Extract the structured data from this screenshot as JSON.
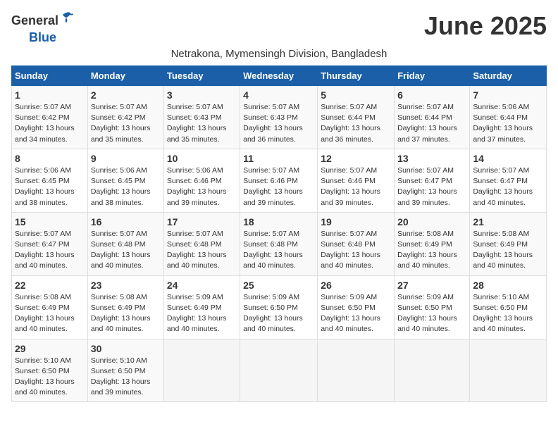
{
  "logo": {
    "general": "General",
    "blue": "Blue"
  },
  "title": "June 2025",
  "subtitle": "Netrakona, Mymensingh Division, Bangladesh",
  "headers": [
    "Sunday",
    "Monday",
    "Tuesday",
    "Wednesday",
    "Thursday",
    "Friday",
    "Saturday"
  ],
  "weeks": [
    [
      {
        "day": "1",
        "info": "Sunrise: 5:07 AM\nSunset: 6:42 PM\nDaylight: 13 hours\nand 34 minutes."
      },
      {
        "day": "2",
        "info": "Sunrise: 5:07 AM\nSunset: 6:42 PM\nDaylight: 13 hours\nand 35 minutes."
      },
      {
        "day": "3",
        "info": "Sunrise: 5:07 AM\nSunset: 6:43 PM\nDaylight: 13 hours\nand 35 minutes."
      },
      {
        "day": "4",
        "info": "Sunrise: 5:07 AM\nSunset: 6:43 PM\nDaylight: 13 hours\nand 36 minutes."
      },
      {
        "day": "5",
        "info": "Sunrise: 5:07 AM\nSunset: 6:44 PM\nDaylight: 13 hours\nand 36 minutes."
      },
      {
        "day": "6",
        "info": "Sunrise: 5:07 AM\nSunset: 6:44 PM\nDaylight: 13 hours\nand 37 minutes."
      },
      {
        "day": "7",
        "info": "Sunrise: 5:06 AM\nSunset: 6:44 PM\nDaylight: 13 hours\nand 37 minutes."
      }
    ],
    [
      {
        "day": "8",
        "info": "Sunrise: 5:06 AM\nSunset: 6:45 PM\nDaylight: 13 hours\nand 38 minutes."
      },
      {
        "day": "9",
        "info": "Sunrise: 5:06 AM\nSunset: 6:45 PM\nDaylight: 13 hours\nand 38 minutes."
      },
      {
        "day": "10",
        "info": "Sunrise: 5:06 AM\nSunset: 6:46 PM\nDaylight: 13 hours\nand 39 minutes."
      },
      {
        "day": "11",
        "info": "Sunrise: 5:07 AM\nSunset: 6:46 PM\nDaylight: 13 hours\nand 39 minutes."
      },
      {
        "day": "12",
        "info": "Sunrise: 5:07 AM\nSunset: 6:46 PM\nDaylight: 13 hours\nand 39 minutes."
      },
      {
        "day": "13",
        "info": "Sunrise: 5:07 AM\nSunset: 6:47 PM\nDaylight: 13 hours\nand 39 minutes."
      },
      {
        "day": "14",
        "info": "Sunrise: 5:07 AM\nSunset: 6:47 PM\nDaylight: 13 hours\nand 40 minutes."
      }
    ],
    [
      {
        "day": "15",
        "info": "Sunrise: 5:07 AM\nSunset: 6:47 PM\nDaylight: 13 hours\nand 40 minutes."
      },
      {
        "day": "16",
        "info": "Sunrise: 5:07 AM\nSunset: 6:48 PM\nDaylight: 13 hours\nand 40 minutes."
      },
      {
        "day": "17",
        "info": "Sunrise: 5:07 AM\nSunset: 6:48 PM\nDaylight: 13 hours\nand 40 minutes."
      },
      {
        "day": "18",
        "info": "Sunrise: 5:07 AM\nSunset: 6:48 PM\nDaylight: 13 hours\nand 40 minutes."
      },
      {
        "day": "19",
        "info": "Sunrise: 5:07 AM\nSunset: 6:48 PM\nDaylight: 13 hours\nand 40 minutes."
      },
      {
        "day": "20",
        "info": "Sunrise: 5:08 AM\nSunset: 6:49 PM\nDaylight: 13 hours\nand 40 minutes."
      },
      {
        "day": "21",
        "info": "Sunrise: 5:08 AM\nSunset: 6:49 PM\nDaylight: 13 hours\nand 40 minutes."
      }
    ],
    [
      {
        "day": "22",
        "info": "Sunrise: 5:08 AM\nSunset: 6:49 PM\nDaylight: 13 hours\nand 40 minutes."
      },
      {
        "day": "23",
        "info": "Sunrise: 5:08 AM\nSunset: 6:49 PM\nDaylight: 13 hours\nand 40 minutes."
      },
      {
        "day": "24",
        "info": "Sunrise: 5:09 AM\nSunset: 6:49 PM\nDaylight: 13 hours\nand 40 minutes."
      },
      {
        "day": "25",
        "info": "Sunrise: 5:09 AM\nSunset: 6:50 PM\nDaylight: 13 hours\nand 40 minutes."
      },
      {
        "day": "26",
        "info": "Sunrise: 5:09 AM\nSunset: 6:50 PM\nDaylight: 13 hours\nand 40 minutes."
      },
      {
        "day": "27",
        "info": "Sunrise: 5:09 AM\nSunset: 6:50 PM\nDaylight: 13 hours\nand 40 minutes."
      },
      {
        "day": "28",
        "info": "Sunrise: 5:10 AM\nSunset: 6:50 PM\nDaylight: 13 hours\nand 40 minutes."
      }
    ],
    [
      {
        "day": "29",
        "info": "Sunrise: 5:10 AM\nSunset: 6:50 PM\nDaylight: 13 hours\nand 40 minutes."
      },
      {
        "day": "30",
        "info": "Sunrise: 5:10 AM\nSunset: 6:50 PM\nDaylight: 13 hours\nand 39 minutes."
      },
      {
        "day": "",
        "info": ""
      },
      {
        "day": "",
        "info": ""
      },
      {
        "day": "",
        "info": ""
      },
      {
        "day": "",
        "info": ""
      },
      {
        "day": "",
        "info": ""
      }
    ]
  ]
}
